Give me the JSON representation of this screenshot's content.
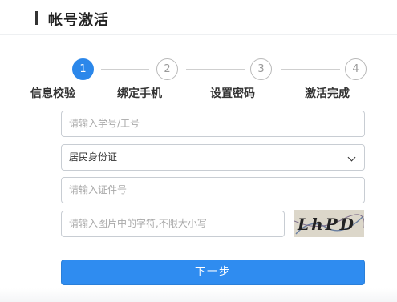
{
  "header": {
    "title": "帐号激活"
  },
  "steps": [
    {
      "number": "1",
      "label": "信息校验",
      "active": true
    },
    {
      "number": "2",
      "label": "绑定手机",
      "active": false
    },
    {
      "number": "3",
      "label": "设置密码",
      "active": false
    },
    {
      "number": "4",
      "label": "激活完成",
      "active": false
    }
  ],
  "form": {
    "student_id": {
      "placeholder": "请输入学号/工号",
      "value": ""
    },
    "id_type": {
      "value": "居民身份证"
    },
    "id_number": {
      "placeholder": "请输入证件号",
      "value": ""
    },
    "captcha_input": {
      "placeholder": "请输入图片中的字符,不限大小写",
      "value": ""
    },
    "captcha_image": {
      "text": "LhPD"
    }
  },
  "next_button": {
    "label": "下一步"
  },
  "colors": {
    "accent": "#2b87ea",
    "button": "#2f8cf0",
    "inactive_step": "#b9b9b9",
    "border": "#c8cdd3"
  }
}
